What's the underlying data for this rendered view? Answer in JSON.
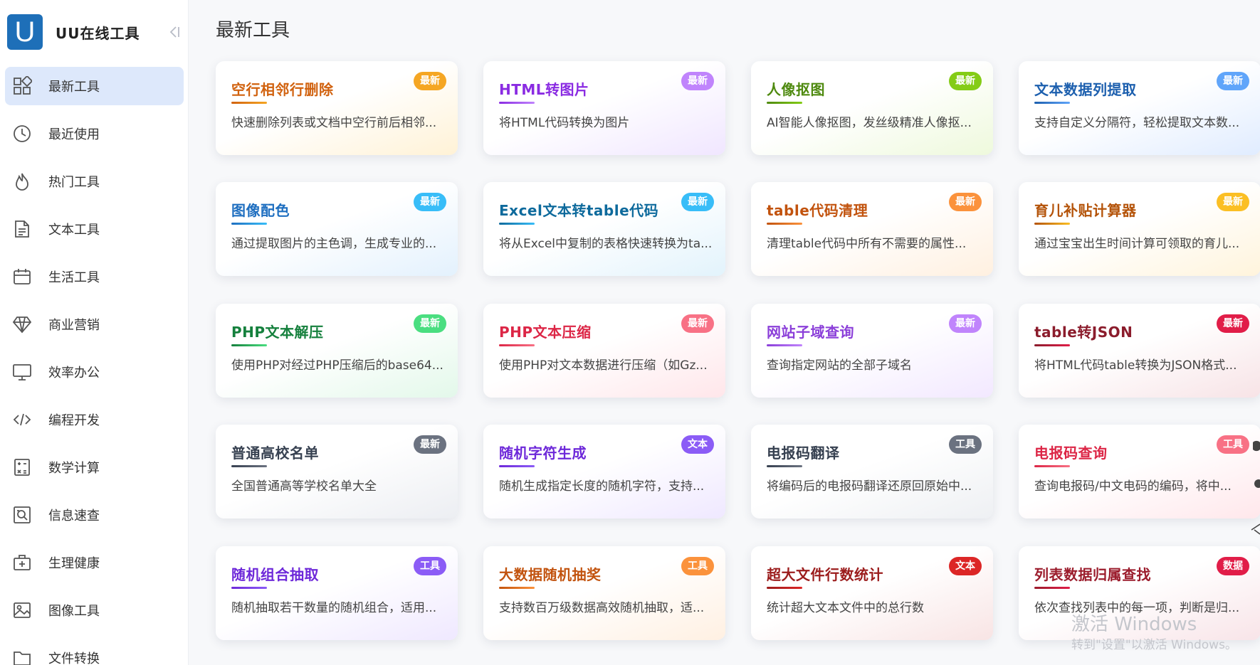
{
  "app": {
    "logo_letter": "U",
    "name": "UU在线工具"
  },
  "sidebar": {
    "items": [
      {
        "label": "最新工具",
        "icon": "grid-icon",
        "active": true
      },
      {
        "label": "最近使用",
        "icon": "clock-icon",
        "active": false
      },
      {
        "label": "热门工具",
        "icon": "fire-icon",
        "active": false
      },
      {
        "label": "文本工具",
        "icon": "document-icon",
        "active": false
      },
      {
        "label": "生活工具",
        "icon": "calendar-icon",
        "active": false
      },
      {
        "label": "商业营销",
        "icon": "diamond-icon",
        "active": false
      },
      {
        "label": "效率办公",
        "icon": "monitor-icon",
        "active": false
      },
      {
        "label": "编程开发",
        "icon": "code-icon",
        "active": false
      },
      {
        "label": "数学计算",
        "icon": "calculator-icon",
        "active": false
      },
      {
        "label": "信息速查",
        "icon": "search-doc-icon",
        "active": false
      },
      {
        "label": "生理健康",
        "icon": "medical-kit-icon",
        "active": false
      },
      {
        "label": "图像工具",
        "icon": "image-icon",
        "active": false
      },
      {
        "label": "文件转换",
        "icon": "folder-icon",
        "active": false
      }
    ]
  },
  "main": {
    "title": "最新工具"
  },
  "cards": [
    {
      "title": "空行相邻行删除",
      "desc": "快速删除列表或文档中空行前后相邻...",
      "badge": "最新",
      "color": "#d1620f",
      "badge_color": "#f5a623",
      "tint": "#fff2d6"
    },
    {
      "title": "HTML转图片",
      "desc": "将HTML代码转换为图片",
      "badge": "最新",
      "color": "#8a2be2",
      "badge_color": "#c084fc",
      "tint": "#f0e6ff"
    },
    {
      "title": "人像抠图",
      "desc": "AI智能人像抠图，发丝级精准人像抠...",
      "badge": "最新",
      "color": "#4f8a10",
      "badge_color": "#84cc16",
      "tint": "#eef9dc"
    },
    {
      "title": "文本数据列提取",
      "desc": "支持自定义分隔符，轻松提取文本数...",
      "badge": "最新",
      "color": "#1c5fae",
      "badge_color": "#60a5fa",
      "tint": "#e0ecff"
    },
    {
      "title": "图像配色",
      "desc": "通过提取图片的主色调，生成专业的...",
      "badge": "最新",
      "color": "#1f6fc0",
      "badge_color": "#38bdf8",
      "tint": "#e3f1fd"
    },
    {
      "title": "Excel文本转table代码",
      "desc": "将从Excel中复制的表格快速转换为ta...",
      "badge": "最新",
      "color": "#0e6a9c",
      "badge_color": "#38bdf8",
      "tint": "#e2f3fc"
    },
    {
      "title": "table代码清理",
      "desc": "清理table代码中所有不需要的属性...",
      "badge": "最新",
      "color": "#c2530e",
      "badge_color": "#fb923c",
      "tint": "#fff0e0"
    },
    {
      "title": "育儿补贴计算器",
      "desc": "通过宝宝出生时间计算可领取的育儿...",
      "badge": "最新",
      "color": "#b45309",
      "badge_color": "#fbbf24",
      "tint": "#fff4dc"
    },
    {
      "title": "PHP文本解压",
      "desc": "使用PHP对经过PHP压缩后的base64...",
      "badge": "最新",
      "color": "#15803d",
      "badge_color": "#4ade80",
      "tint": "#e3f8ea"
    },
    {
      "title": "PHP文本压缩",
      "desc": "使用PHP对文本数据进行压缩（如Gz...",
      "badge": "最新",
      "color": "#dc2646",
      "badge_color": "#f87185",
      "tint": "#ffe6ea"
    },
    {
      "title": "网站子域查询",
      "desc": "查询指定网站的全部子域名",
      "badge": "最新",
      "color": "#8b3fd9",
      "badge_color": "#c084fc",
      "tint": "#f2e8ff"
    },
    {
      "title": "table转JSON",
      "desc": "将HTML代码table转换为JSON格式...",
      "badge": "最新",
      "color": "#8b1c2c",
      "badge_color": "#e11d48",
      "tint": "#f7e3e6"
    },
    {
      "title": "普通高校名单",
      "desc": "全国普通高等学校名单大全",
      "badge": "最新",
      "color": "#374151",
      "badge_color": "#6b7280",
      "tint": "#eceef2"
    },
    {
      "title": "随机字符生成",
      "desc": "随机生成指定长度的随机字符，支持...",
      "badge": "文本",
      "color": "#6d28d9",
      "badge_color": "#8b5cf6",
      "tint": "#efe8ff"
    },
    {
      "title": "电报码翻译",
      "desc": "将编码后的电报码翻译还原回原始中...",
      "badge": "工具",
      "color": "#374151",
      "badge_color": "#6b7280",
      "tint": "#eef0f3"
    },
    {
      "title": "电报码查询",
      "desc": "查询电报码/中文电码的编码，将中...",
      "badge": "工具",
      "color": "#dc2646",
      "badge_color": "#f87185",
      "tint": "#ffe7eb"
    },
    {
      "title": "随机组合抽取",
      "desc": "随机抽取若干数量的随机组合，适用...",
      "badge": "工具",
      "color": "#6d28d9",
      "badge_color": "#8b5cf6",
      "tint": "#efe8ff"
    },
    {
      "title": "大数据随机抽奖",
      "desc": "支持数百万级数据高效随机抽取，适...",
      "badge": "工具",
      "color": "#c2530e",
      "badge_color": "#fb923c",
      "tint": "#fff0e2"
    },
    {
      "title": "超大文件行数统计",
      "desc": "统计超大文本文件中的总行数",
      "badge": "文本",
      "color": "#9b1c1c",
      "badge_color": "#dc2626",
      "tint": "#f8e4e4"
    },
    {
      "title": "列表数据归属查找",
      "desc": "依次查找列表中的每一项，判断是归...",
      "badge": "数据",
      "color": "#9b1c2c",
      "badge_color": "#e11d48",
      "tint": "#f8e4e8"
    }
  ],
  "watermark": {
    "line1": "激活 Windows",
    "line2": "转到\"设置\"以激活 Windows。"
  }
}
